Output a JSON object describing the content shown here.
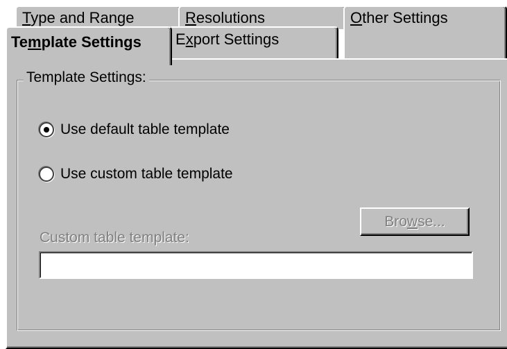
{
  "tabs": {
    "type_range": {
      "label_pre": "",
      "label_key": "T",
      "label_post": "ype and Range"
    },
    "resolutions": {
      "label_pre": "",
      "label_key": "R",
      "label_post": "esolutions"
    },
    "other_settings": {
      "label_pre": "",
      "label_key": "O",
      "label_post": "ther Settings"
    },
    "template_settings": {
      "label_pre": "Te",
      "label_key": "m",
      "label_post": "plate Settings",
      "selected": true
    },
    "export_settings": {
      "label_pre": "E",
      "label_key": "x",
      "label_post": "port Settings"
    }
  },
  "group": {
    "title": "Template Settings:"
  },
  "options": {
    "default_label": "Use default table template",
    "custom_label": "Use custom table template",
    "selected": "default"
  },
  "browse": {
    "label_pre": "Bro",
    "label_key": "w",
    "label_post": "se...",
    "enabled": false
  },
  "custom_template": {
    "label": "Custom table template:",
    "value": "",
    "enabled": false
  }
}
